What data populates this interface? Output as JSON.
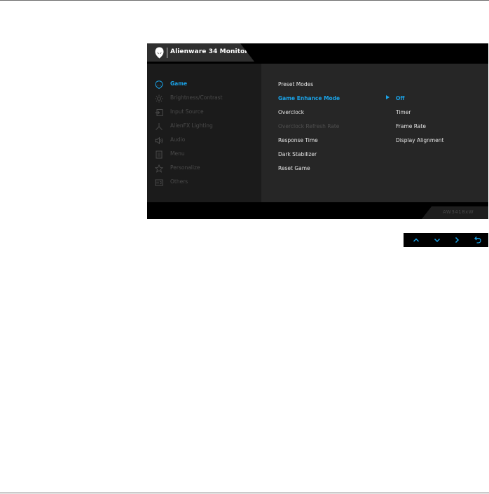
{
  "monitor": {
    "title": "Alienware 34 Monitor",
    "model": "AW3418xW"
  },
  "menu": {
    "items": [
      {
        "label": "Game",
        "icon": "alien-head-icon",
        "active": true
      },
      {
        "label": "Brightness/Contrast",
        "icon": "brightness-icon",
        "active": false
      },
      {
        "label": "Input Source",
        "icon": "input-source-icon",
        "active": false
      },
      {
        "label": "AlienFX Lighting",
        "icon": "alienfx-lighting-icon",
        "active": false
      },
      {
        "label": "Audio",
        "icon": "speaker-icon",
        "active": false
      },
      {
        "label": "Menu",
        "icon": "menu-document-icon",
        "active": false
      },
      {
        "label": "Personalize",
        "icon": "star-icon",
        "active": false
      },
      {
        "label": "Others",
        "icon": "others-icon",
        "active": false
      }
    ]
  },
  "submenu": {
    "items": [
      {
        "label": "Preset Modes",
        "state": "normal"
      },
      {
        "label": "Game Enhance Mode",
        "state": "active"
      },
      {
        "label": "Overclock",
        "state": "normal"
      },
      {
        "label": "Overclock Refresh Rate",
        "state": "disabled"
      },
      {
        "label": "Response Time",
        "state": "normal"
      },
      {
        "label": "Dark Stabilizer",
        "state": "normal"
      },
      {
        "label": "Reset Game",
        "state": "normal"
      }
    ]
  },
  "options": {
    "items": [
      {
        "label": "Off",
        "selected": true
      },
      {
        "label": "Timer",
        "selected": false
      },
      {
        "label": "Frame Rate",
        "selected": false
      },
      {
        "label": "Display Alignment",
        "selected": false
      }
    ]
  },
  "nav_buttons": [
    "up-arrow-icon",
    "down-arrow-icon",
    "right-arrow-icon",
    "back-return-icon"
  ],
  "colors": {
    "accent": "#1aa3e8",
    "osd_background": "#000000",
    "left_panel": "#1b1b1b",
    "right_panel": "#262626",
    "title_tab": "#2f2f2f",
    "inactive_text": "#4a4a4a"
  }
}
